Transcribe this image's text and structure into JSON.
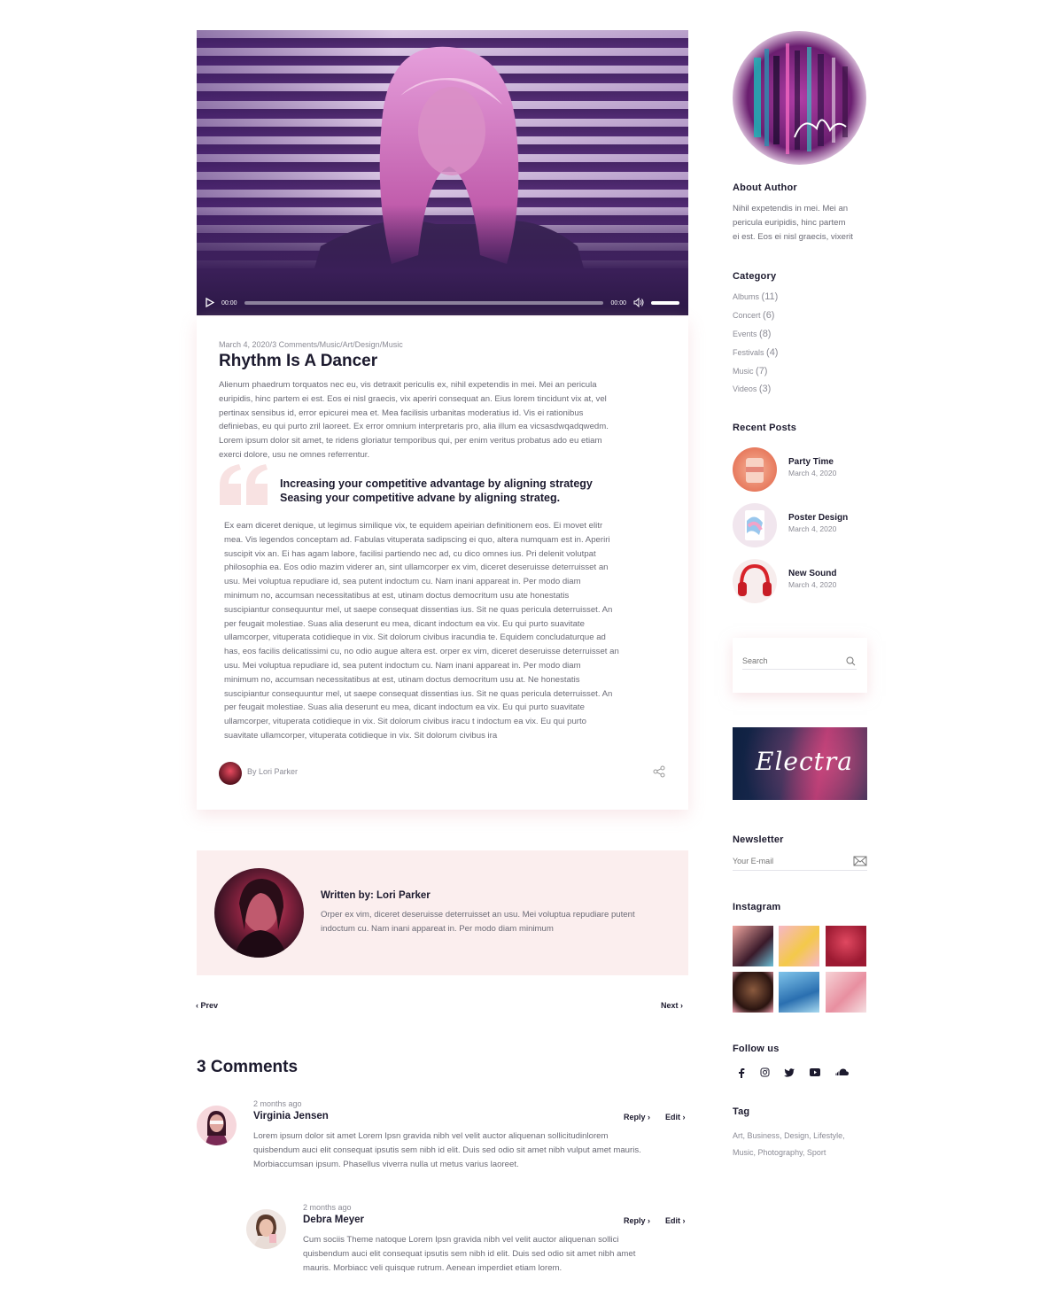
{
  "video": {
    "time_current": "00:00",
    "time_total": "00:00"
  },
  "article": {
    "meta": {
      "date": "March 4, 2020",
      "comments": "3 Comments",
      "cats": [
        "Music",
        "Art",
        "Design",
        "Music"
      ]
    },
    "title": "Rhythm Is A Dancer",
    "intro": [
      "Alienum phaedrum torquatos nec eu, vis detraxit periculis ex, nihil expetendis in mei. Mei an pericula",
      "euripidis, hinc partem ei est. Eos ei nisl graecis, vix aperiri consequat an. Eius lorem tincidunt vix at, vel",
      "pertinax sensibus id, error epicurei mea et. Mea facilisis urbanitas moderatius id. Vis ei rationibus",
      "definiebas, eu qui purto zril laoreet. Ex error omnium interpretaris pro, alia illum ea vicsasdwqadqwedm.",
      "Lorem ipsum dolor sit amet, te ridens gloriatur temporibus qui, per enim veritus probatus ado eu etiam",
      "exerci dolore, usu ne omnes referrentur."
    ],
    "quote": [
      "Increasing your competitive advantage by aligning strategy",
      "Seasing your competitive advane by aligning strateg."
    ],
    "body": [
      "Ex eam diceret denique, ut legimus similique vix, te equidem apeirian definitionem eos. Ei movet elitr",
      "mea. Vis legendos conceptam ad. Fabulas vituperata sadipscing ei quo, altera numquam est in. Aperiri",
      "suscipit vix an. Ei has agam labore, facilisi partiendo nec ad, cu dico omnes ius. Pri delenit volutpat",
      "philosophia ea. Eos odio mazim viderer an, sint ullamcorper ex vim, diceret deseruisse deterruisset an",
      "usu. Mei voluptua repudiare id, sea putent indoctum cu. Nam inani appareat in. Per modo diam",
      "minimum no, accumsan necessitatibus at est, utinam doctus democritum usu ate honestatis",
      "suscipiantur consequuntur mel, ut saepe consequat dissentias ius. Sit ne quas pericula deterruisset. An",
      "per feugait molestiae. Suas alia deserunt eu mea, dicant indoctum ea vix. Eu qui purto suavitate",
      "ullamcorper, vituperata cotidieque in vix. Sit dolorum civibus iracundia te. Equidem concludaturque ad",
      "has, eos facilis delicatissimi cu, no odio augue altera est. orper ex vim, diceret deseruisse deterruisset an",
      "usu. Mei voluptua repudiare id, sea putent indoctum cu. Nam inani appareat in. Per modo diam",
      "minimum no, accumsan necessitatibus at est, utinam doctus democritum usu at. Ne honestatis",
      "suscipiantur consequuntur mel, ut saepe consequat dissentias ius. Sit ne quas pericula deterruisset. An",
      "per feugait molestiae. Suas alia deserunt eu mea, dicant indoctum ea vix. Eu qui purto suavitate",
      "ullamcorper, vituperata cotidieque in vix. Sit dolorum civibus iracu t indoctum ea vix. Eu qui purto",
      "suavitate ullamcorper, vituperata cotidieque in vix. Sit dolorum civibus ira"
    ],
    "byline": "By Lori Parker"
  },
  "author_box": {
    "title": "Written by: Lori Parker",
    "text": [
      "Orper ex vim, diceret deseruisse deterruisset an usu. Mei voluptua repudiare putent",
      "indoctum cu. Nam inani appareat in. Per modo diam minimum"
    ]
  },
  "nav": {
    "prev": "Prev",
    "next": "Next"
  },
  "comments": {
    "title": "3 Comments",
    "items": [
      {
        "ago": "2 months ago",
        "name": "Virginia Jensen",
        "reply": "Reply",
        "edit": "Edit",
        "text": [
          "Lorem ipsum dolor sit amet Lorem Ipsn gravida nibh vel velit auctor aliquenan sollicitudinlorem",
          "quisbendum auci elit consequat ipsutis sem nibh id elit. Duis sed odio sit amet nibh vulput amet mauris.",
          "Morbiaccumsan ipsum. Phasellus viverra nulla ut metus varius laoreet."
        ]
      },
      {
        "ago": "2 months ago",
        "name": "Debra Meyer",
        "reply": "Reply",
        "edit": "Edit",
        "text": [
          "Cum sociis Theme natoque Lorem Ipsn gravida nibh vel velit auctor aliquenan sollici",
          "quisbendum auci elit consequat ipsutis sem nibh id elit. Duis sed odio sit amet nibh amet",
          "mauris. Morbiacc veli quisque rutrum. Aenean imperdiet etiam lorem."
        ]
      }
    ]
  },
  "sidebar": {
    "about": {
      "title": "About Author",
      "text": [
        "Nihil expetendis in mei. Mei an",
        "pericula euripidis, hinc partem",
        "ei est. Eos ei nisl graecis, vixerit"
      ]
    },
    "category": {
      "title": "Category",
      "items": [
        {
          "label": "Albums",
          "count": "(11)"
        },
        {
          "label": "Concert",
          "count": "(6)"
        },
        {
          "label": "Events",
          "count": "(8)"
        },
        {
          "label": "Festivals",
          "count": "(4)"
        },
        {
          "label": "Music",
          "count": "(7)"
        },
        {
          "label": "Videos",
          "count": "(3)"
        }
      ]
    },
    "recent": {
      "title": "Recent Posts",
      "items": [
        {
          "title": "Party Time",
          "date": "March 4, 2020"
        },
        {
          "title": "Poster Design",
          "date": "March 4, 2020"
        },
        {
          "title": "New Sound",
          "date": "March 4, 2020"
        }
      ]
    },
    "search": {
      "placeholder": "Search"
    },
    "banner": {
      "text": "Electra"
    },
    "newsletter": {
      "title": "Newsletter",
      "placeholder": "Your E-mail"
    },
    "instagram": {
      "title": "Instagram"
    },
    "follow": {
      "title": "Follow us"
    },
    "tag": {
      "title": "Tag",
      "items": [
        "Art",
        "Business",
        "Design",
        "Lifestyle",
        "Music",
        "Photography",
        "Sport"
      ]
    }
  }
}
